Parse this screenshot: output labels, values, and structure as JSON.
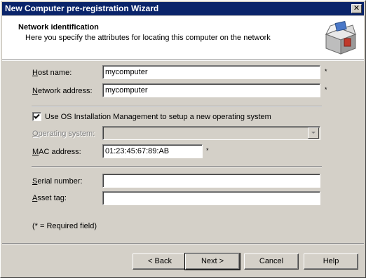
{
  "window": {
    "title": "New Computer pre-registration Wizard",
    "close_glyph": "✕"
  },
  "header": {
    "title": "Network identification",
    "subtitle": "Here you specify the attributes for locating this computer on the network",
    "icon": "package-box-icon"
  },
  "form": {
    "host_name": {
      "label": "Host name:",
      "value": "mycomputer",
      "required_mark": "*"
    },
    "network_address": {
      "label": "Network address:",
      "value": "mycomputer",
      "required_mark": "*"
    },
    "os_install_checkbox": {
      "label": "Use OS Installation Management to setup a new operating system",
      "checked": true
    },
    "operating_system": {
      "label": "Operating system:",
      "value": "",
      "disabled": true
    },
    "mac_address": {
      "label": "MAC address:",
      "value": "01:23:45:67:89:AB",
      "required_mark": "*"
    },
    "serial_number": {
      "label": "Serial number:",
      "value": ""
    },
    "asset_tag": {
      "label": "Asset tag:",
      "value": ""
    },
    "required_note": "(* = Required field)"
  },
  "buttons": {
    "back": "< Back",
    "next": "Next >",
    "cancel": "Cancel",
    "help": "Help"
  },
  "colors": {
    "title_bar": "#0a246a",
    "dialog_face": "#d4d0c8"
  }
}
